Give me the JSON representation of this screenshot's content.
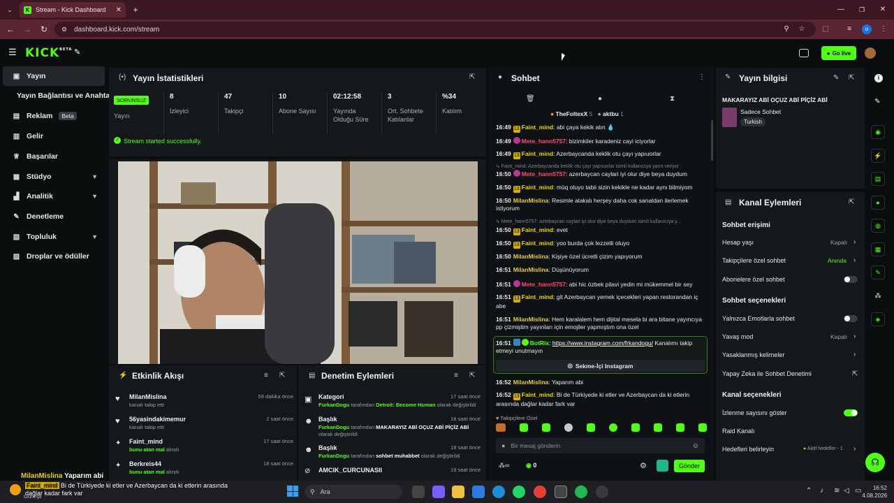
{
  "browser": {
    "tab_title": "Stream - Kick Dashboard",
    "url": "dashboard.kick.com/stream",
    "profile_initial": "o"
  },
  "header": {
    "logo": "KICK",
    "logo_sup": "BETA",
    "go_live": "Go live"
  },
  "sidebar": {
    "items": [
      {
        "label": "Yayın"
      },
      {
        "label": "Yayın Bağlantısı ve Anahtarı"
      },
      {
        "label": "Reklam",
        "badge": "Beta"
      },
      {
        "label": "Gelir"
      },
      {
        "label": "Başarılar"
      },
      {
        "label": "Stüdyo"
      },
      {
        "label": "Analitik"
      },
      {
        "label": "Denetleme"
      },
      {
        "label": "Topluluk"
      },
      {
        "label": "Droplar ve ödüller"
      }
    ]
  },
  "stats": {
    "title": "Yayın İstatistikleri",
    "status_badge": "SORUNSUZ",
    "status_label": "Yayın",
    "cells": [
      {
        "value": "8",
        "label": "İzleyici"
      },
      {
        "value": "47",
        "label": "Takipçi"
      },
      {
        "value": "10",
        "label": "Abone Sayısı"
      },
      {
        "value": "02:12:58",
        "label": "Yayında Olduğu Süre"
      },
      {
        "value": "3",
        "label": "Ort. Sohbete Katılanlar"
      },
      {
        "value": "%34",
        "label": "Katılım"
      }
    ],
    "success_msg": "Stream started successfully."
  },
  "activity": {
    "title": "Etkinlik Akışı",
    "items": [
      {
        "name": "MilanMislina",
        "sub": "kanalı takip etti",
        "time": "59 dakika önce"
      },
      {
        "name": "56yasindakimemur",
        "sub": "kanalı takip etti",
        "time": "2 saat önce"
      },
      {
        "name": "Faint_mind",
        "sub_hl": "bunu atan mal",
        "sub": " alındı",
        "time": "17 saat önce"
      },
      {
        "name": "Berkreis44",
        "sub_hl": "bunu atan mal",
        "sub": " alındı",
        "time": "18 saat önce"
      }
    ]
  },
  "moderation": {
    "title": "Denetim Eylemleri",
    "items": [
      {
        "title": "Kategori",
        "who": "FurkanDogu",
        "mid": " tarafından ",
        "val": "Detroit: Become Human",
        "end": " olarak değiştirildi",
        "time": "17 saat önce"
      },
      {
        "title": "Başlık",
        "who": "FurkanDogu",
        "mid": " tarafından ",
        "val": "MAKARAYIZ ABİ OÇUZ ABİ PİÇİZ ABİ",
        "end": " olarak değiştirildi",
        "time": "18 saat önce"
      },
      {
        "title": "Başlık",
        "who": "FurkanDogu",
        "mid": " tarafından ",
        "val": "sohbet muhabbet",
        "end": " olarak değiştirildi",
        "time": "18 saat önce"
      },
      {
        "title": "AMCIK_CURCUNASII",
        "who": "",
        "mid": "",
        "val": "",
        "end": "",
        "time": "19 saat önce"
      }
    ]
  },
  "chat": {
    "title": "Sohbet",
    "top_gifters": [
      {
        "name": "TheFoltexX",
        "count": "5"
      },
      {
        "name": "aktbu",
        "count": "1"
      }
    ],
    "messages": [
      {
        "t": "16:49",
        "b": "13",
        "u": "Faint_mind",
        "c": "u-y",
        "m": ": abi çaya kekik atın"
      },
      {
        "t": "16:49",
        "b": "p",
        "u": "Mete_hann5757",
        "c": "u-p",
        "m": ": bizimkiler karadeniz cayi iciyorlar"
      },
      {
        "t": "16:49",
        "b": "13",
        "u": "Faint_mind",
        "c": "u-y",
        "m": ": Azerbaycanda keklik otu çayı yapıuorlar"
      },
      {
        "reply": "↳ Faint_mind: Azerbaycanda keklik otu çayı yapıuorlar isimli kullanıcıya yanıt veriyor"
      },
      {
        "t": "16:50",
        "b": "p",
        "u": "Mete_hann5757",
        "c": "u-p",
        "m": ": azerbaycan caylari iyi olur diye beya duydum"
      },
      {
        "t": "16:50",
        "b": "13",
        "u": "Faint_mind",
        "c": "u-y",
        "m": ": müq oluyo tabii sizin kekikle ne kadar aynı bilmiyom"
      },
      {
        "t": "16:50",
        "b": "",
        "u": "MilanMislina",
        "c": "u-m",
        "m": ": Resimle alakalı herşey daha cok sanaldan ilerlemek istiyorum"
      },
      {
        "reply": "↳ Mete_hann5757: azerbaycan caylari iyi olur diye beya duydum isimli kullanıcıya y..."
      },
      {
        "t": "16:50",
        "b": "13",
        "u": "Faint_mind",
        "c": "u-y",
        "m": ": evet"
      },
      {
        "t": "16:50",
        "b": "13",
        "u": "Faint_mind",
        "c": "u-y",
        "m": ": yoo burda çok lezzetli oluyo"
      },
      {
        "t": "16:50",
        "b": "",
        "u": "MilanMislina",
        "c": "u-m",
        "m": ": Kişiye özel ücretli çizim yapıyorum"
      },
      {
        "t": "16:51",
        "b": "",
        "u": "MilanMislina",
        "c": "u-m",
        "m": ": Düşünüyorum"
      },
      {
        "t": "16:51",
        "b": "p",
        "u": "Mete_hann5757",
        "c": "u-p",
        "m": ": abi hic özbek pilavi yedin mi mükemmel bir sey"
      },
      {
        "t": "16:51",
        "b": "13",
        "u": "Faint_mind",
        "c": "u-y",
        "m": ": git Azerbaycan yemek içecekleri yapan restorandan iç abe"
      },
      {
        "t": "16:51",
        "b": "",
        "u": "MilanMislina",
        "c": "u-m",
        "m": ": Hem karalalem hem dijital mesela bi ara bitane yayıncıya pp çizmiştim yayınları için emojiler yapmıştım ona özel"
      }
    ],
    "botrix": {
      "t": "16:51",
      "u": "BotRix",
      "link": "https://www.instagram.com/frkandogu/",
      "m": " Kanalımı takip etmeyi unutmayın",
      "btn": "Sekme-İçi Instagram"
    },
    "after": [
      {
        "t": "16:52",
        "b": "",
        "u": "MilanMislina",
        "c": "u-m",
        "m": ": Yaparım abi"
      },
      {
        "t": "16:52",
        "b": "13",
        "u": "Faint_mind",
        "c": "u-y",
        "m": ": Bi de Türkiyede ki etler ve Azerbaycan da ki etlerin arasında dağlar kadar fark var"
      }
    ],
    "followers_only": "Takipçilere Özel",
    "input_placeholder": "Bir mesaj gönderin",
    "points": "0",
    "send": "Gönder"
  },
  "stream_info": {
    "title": "Yayın bilgisi",
    "stream_title": "MAKARAYIZ ABİ OÇUZ ABİ PİÇİZ ABİ",
    "category": "Sadece Sohbet",
    "tag": "Turkish"
  },
  "channel_actions": {
    "title": "Kanal Eylemleri",
    "chat_access": "Sohbet erişimi",
    "account_age": "Hesap yaşı",
    "account_age_val": "Kapalı",
    "followers_chat": "Takipçilere özel sohbet",
    "followers_chat_val": "Anında",
    "subs_chat": "Abonelere özel sohbet",
    "chat_options": "Sohbet seçenekleri",
    "emote_only": "Yalnızca Emotlarla sohbet",
    "slow_mode": "Yavaş mod",
    "slow_mode_val": "Kapalı",
    "banned_words": "Yasaklanmış kelimeler",
    "ai_mod": "Yapay Zeka ile Sohbet Denetimi",
    "channel_options": "Kanal seçenekleri",
    "show_viewers": "İzlenme sayısını göster",
    "raid": "Raid Kanalı",
    "goals": "Hedefleri belirleyin",
    "goals_val": "Aktif hedefler - 1"
  },
  "overlay": {
    "name1": "MilanMislina",
    "msg1": "Yaparım abi",
    "name2": "Faint_mind",
    "msg2": "Bi de Türkiyede ki etler ve Azerbaycan da ki etlerin arasında dağlar kadar fark var"
  },
  "taskbar": {
    "weather": "Güneşli",
    "search": "Ara",
    "time": "16:52",
    "date": "4.08.2026"
  },
  "colors": {
    "accent": "#53fc18",
    "panel": "#15181b",
    "bg": "#0b0e0f"
  }
}
